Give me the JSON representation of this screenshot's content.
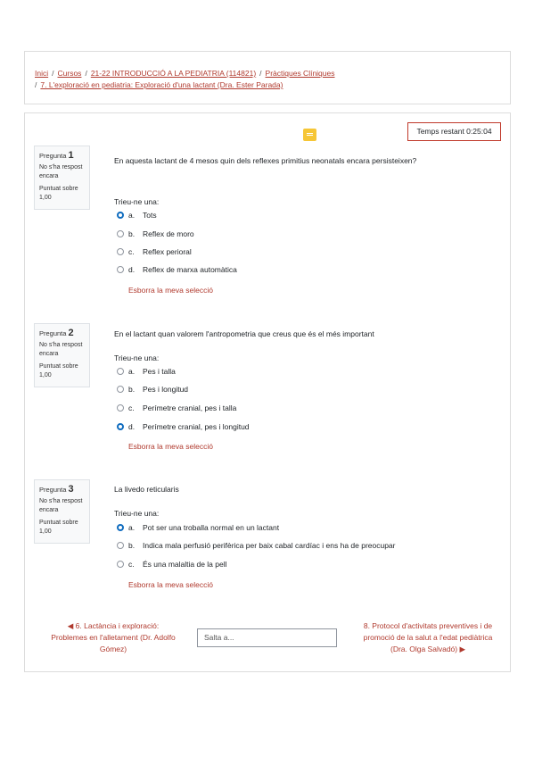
{
  "breadcrumb": {
    "items": [
      "Inici",
      "Cursos",
      "21-22 INTRODUCCIÓ A LA PEDIATRIA (114821)",
      "Pràctiques Clíniques",
      "7. L'exploració en pediatria: Exploració d'una lactant (Dra. Ester Parada)"
    ],
    "separator": "/"
  },
  "timer": {
    "label": "Temps restant 0:25:04"
  },
  "chat_icon": "chat-icon",
  "questions": [
    {
      "label": "Pregunta",
      "number": "1",
      "status": "No s'ha respost encara",
      "grade": "Puntuat sobre 1,00",
      "text": "En aquesta lactant de 4 mesos quin dels reflexes primitius neonatals encara persisteixen?",
      "prompt": "Trieu-ne una:",
      "options": [
        {
          "letter": "a.",
          "text": "Tots",
          "selected": true
        },
        {
          "letter": "b.",
          "text": "Reflex de moro",
          "selected": false
        },
        {
          "letter": "c.",
          "text": "Reflex perioral",
          "selected": false
        },
        {
          "letter": "d.",
          "text": "Reflex de marxa automàtica",
          "selected": false
        }
      ],
      "clear": "Esborra la meva selecció"
    },
    {
      "label": "Pregunta",
      "number": "2",
      "status": "No s'ha respost encara",
      "grade": "Puntuat sobre 1,00",
      "text": "En el lactant quan valorem l'antropometria que creus que és el més important",
      "prompt": "Trieu-ne una:",
      "options": [
        {
          "letter": "a.",
          "text": "Pes i talla",
          "selected": false
        },
        {
          "letter": "b.",
          "text": "Pes i longitud",
          "selected": false
        },
        {
          "letter": "c.",
          "text": "Perímetre cranial, pes i talla",
          "selected": false
        },
        {
          "letter": "d.",
          "text": "Perímetre cranial, pes i longitud",
          "selected": true
        }
      ],
      "clear": "Esborra la meva selecció"
    },
    {
      "label": "Pregunta",
      "number": "3",
      "status": "No s'ha respost encara",
      "grade": "Puntuat sobre 1,00",
      "text": "La livedo reticularis",
      "prompt": "Trieu-ne una:",
      "options": [
        {
          "letter": "a.",
          "text": "Pot ser una troballa normal en un lactant",
          "selected": true
        },
        {
          "letter": "b.",
          "text": "Indica mala perfusió perifèrica per baix cabal cardíac i ens ha de preocupar",
          "selected": false
        },
        {
          "letter": "c.",
          "text": "És una malaltia de la pell",
          "selected": false
        }
      ],
      "clear": "Esborra la meva selecció"
    }
  ],
  "nav": {
    "prev": "◀ 6. Lactància i exploració: Problemes en l'alletament (Dr. Adolfo Gómez)",
    "jump_placeholder": "Salta a...",
    "next": "8. Protocol d'activitats preventives i de promoció de la salut a l'edat pediàtrica (Dra. Olga Salvadó) ▶"
  }
}
